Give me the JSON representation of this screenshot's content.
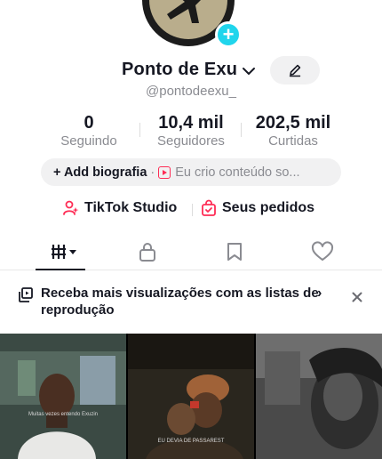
{
  "profile": {
    "name": "Ponto de Exu",
    "handle": "@pontodeexu_",
    "avatar_icon": "profile-photo",
    "add_icon": "plus-icon"
  },
  "stats": [
    {
      "value": "0",
      "label": "Seguindo"
    },
    {
      "value": "10,4 mil",
      "label": "Seguidores"
    },
    {
      "value": "202,5 mil",
      "label": "Curtidas"
    }
  ],
  "bio": {
    "add_label": "+ Add biografia",
    "separator": "·",
    "link_text": "Eu crio conteúdo so..."
  },
  "links": {
    "studio": "TikTok Studio",
    "orders": "Seus pedidos"
  },
  "tabs": [
    {
      "icon": "videos-grid-icon",
      "selected": true
    },
    {
      "icon": "lock-icon",
      "selected": false
    },
    {
      "icon": "bookmark-icon",
      "selected": false
    },
    {
      "icon": "heart-icon",
      "selected": false
    }
  ],
  "banner": {
    "text": "Receba mais visualizações com as listas de reprodução",
    "chevron": "›",
    "close": "×"
  },
  "videos": [
    {
      "caption": "Muitas vezes entendo Exuzin"
    },
    {
      "caption": "EU DEVIA DE PASSAREST"
    },
    {
      "caption": ""
    }
  ],
  "colors": {
    "accent": "#fe2c55",
    "badge": "#20d5ec",
    "text": "#161823",
    "muted": "#8a8b91",
    "pill": "#f1f1f2"
  }
}
